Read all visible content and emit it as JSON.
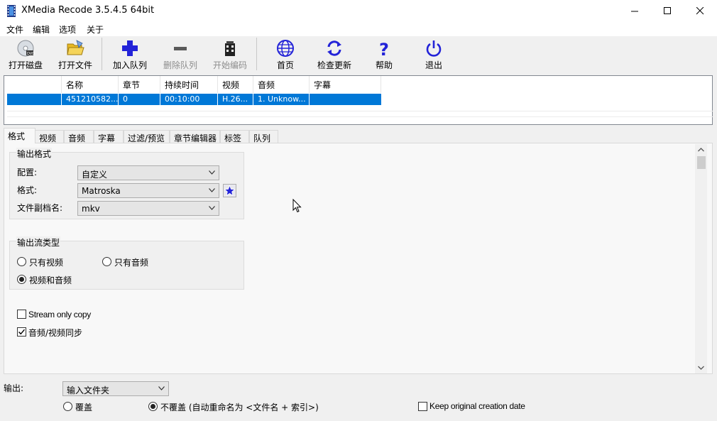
{
  "window": {
    "title": "XMedia Recode 3.5.4.5 64bit"
  },
  "menu": [
    "文件",
    "编辑",
    "选项",
    "关于"
  ],
  "toolbar": {
    "open_disc": "打开磁盘",
    "open_file": "打开文件",
    "add_queue": "加入队列",
    "remove_queue": "删除队列",
    "start_encode": "开始编码",
    "home": "首页",
    "check_update": "检查更新",
    "help": "帮助",
    "exit": "退出"
  },
  "filelist": {
    "headers": [
      "名称",
      "章节",
      "持续时间",
      "视频",
      "音频",
      "字幕"
    ],
    "rows": [
      {
        "name": "451210582...",
        "chapter": "0",
        "duration": "00:10:00",
        "video": "H.26...",
        "audio": "1. Unknow...",
        "subtitle": ""
      }
    ]
  },
  "tabs": [
    "格式",
    "视频",
    "音频",
    "字幕",
    "过滤/预览",
    "章节编辑器",
    "标签",
    "队列"
  ],
  "format": {
    "group_title": "输出格式",
    "profile_label": "配置:",
    "profile_value": "自定义",
    "format_label": "格式:",
    "format_value": "Matroska",
    "ext_label": "文件副档名:",
    "ext_value": "mkv"
  },
  "stream": {
    "group_title": "输出流类型",
    "video_only": "只有视频",
    "audio_only": "只有音频",
    "video_audio": "视频和音频",
    "selected": "video_audio"
  },
  "options": {
    "stream_copy": "Stream only copy",
    "av_sync": "音频/视频同步",
    "stream_copy_checked": false,
    "av_sync_checked": true
  },
  "output": {
    "label": "输出:",
    "value": "输入文件夹",
    "overwrite": "覆盖",
    "no_overwrite": "不覆盖 (自动重命名为 <文件名 + 索引>)",
    "keep_date": "Keep original creation date"
  },
  "colors": {
    "accent": "#0078d7",
    "toolbar_icon": "#2323d8"
  }
}
